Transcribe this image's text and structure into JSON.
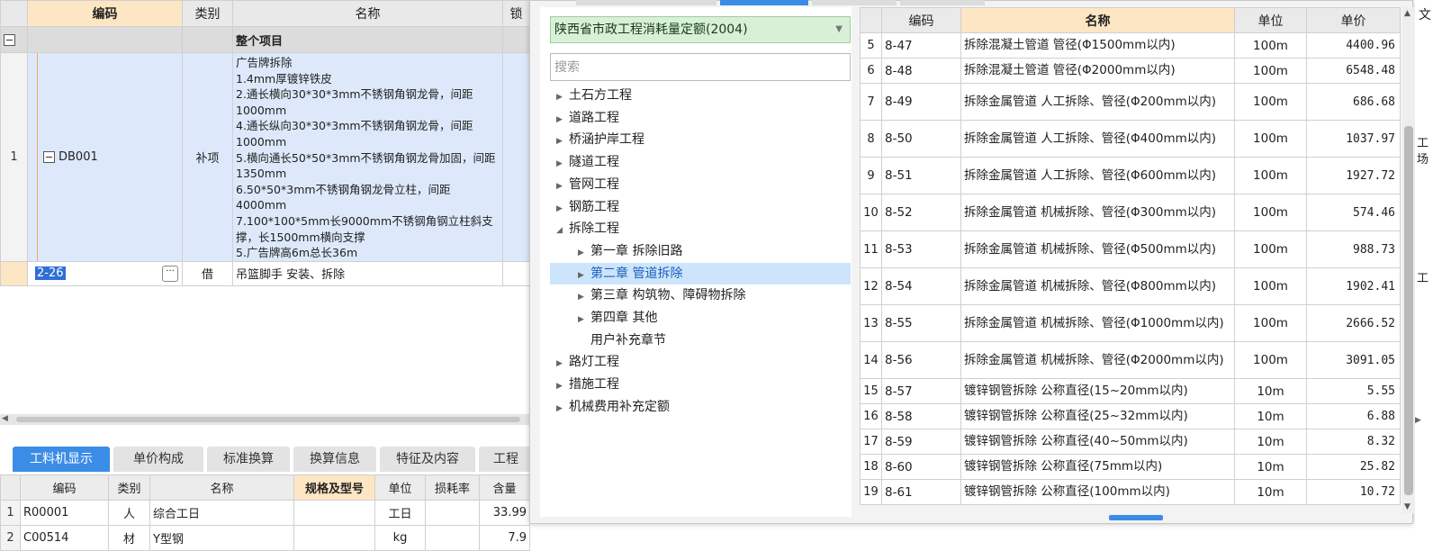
{
  "main_grid": {
    "headers": {
      "code": "编码",
      "type": "类别",
      "name": "名称",
      "lock": "锁"
    },
    "group_row": {
      "name": "整个项目"
    },
    "rows": [
      {
        "num": "1",
        "code": "DB001",
        "type": "补项",
        "desc": [
          "广告牌拆除",
          "1.4mm厚镀锌铁皮",
          "2.通长横向30*30*3mm不锈钢角钢龙骨，间距1000mm",
          "4.通长纵向30*30*3mm不锈钢角钢龙骨，间距1000mm",
          "5.横向通长50*50*3mm不锈钢角钢龙骨加固，间距1350mm",
          "6.50*50*3mm不锈钢角钢龙骨立柱，间距4000mm",
          "7.100*100*5mm长9000mm不锈钢角钢立柱斜支撑，长1500mm横向支撑",
          "5.广告牌高6m总长36m"
        ]
      },
      {
        "num": "",
        "code": "2-26",
        "type": "借",
        "name": "吊篮脚手 安装、拆除"
      }
    ]
  },
  "bottom_tabs": [
    "工料机显示",
    "单价构成",
    "标准换算",
    "换算信息",
    "特征及内容",
    "工程"
  ],
  "bottom_grid": {
    "headers": {
      "code": "编码",
      "type": "类别",
      "name": "名称",
      "spec": "规格及型号",
      "unit": "单位",
      "loss": "损耗率",
      "qty": "含量"
    },
    "rows": [
      {
        "num": "1",
        "code": "R00001",
        "type": "人",
        "name": "综合工日",
        "unit": "工日",
        "qty": "33.99"
      },
      {
        "num": "2",
        "code": "C00514",
        "type": "材",
        "name": "Y型钢",
        "unit": "kg",
        "qty": "7.9"
      }
    ]
  },
  "library": {
    "selected": "陕西省市政工程消耗量定额(2004)",
    "search_placeholder": "搜索",
    "tree": [
      {
        "label": "土石方工程",
        "level": 0,
        "expanded": false
      },
      {
        "label": "道路工程",
        "level": 0,
        "expanded": false
      },
      {
        "label": "桥涵护岸工程",
        "level": 0,
        "expanded": false
      },
      {
        "label": "隧道工程",
        "level": 0,
        "expanded": false
      },
      {
        "label": "管网工程",
        "level": 0,
        "expanded": false
      },
      {
        "label": "钢筋工程",
        "level": 0,
        "expanded": false
      },
      {
        "label": "拆除工程",
        "level": 0,
        "expanded": true
      },
      {
        "label": "第一章 拆除旧路",
        "level": 1,
        "expanded": false
      },
      {
        "label": "第二章 管道拆除",
        "level": 1,
        "expanded": false,
        "selected": true
      },
      {
        "label": "第三章 构筑物、障碍物拆除",
        "level": 1,
        "expanded": false
      },
      {
        "label": "第四章 其他",
        "level": 1,
        "expanded": false
      },
      {
        "label": "用户补充章节",
        "level": 1,
        "leaf": true
      },
      {
        "label": "路灯工程",
        "level": 0,
        "expanded": false
      },
      {
        "label": "措施工程",
        "level": 0,
        "expanded": false
      },
      {
        "label": "机械费用补充定额",
        "level": 0,
        "expanded": false
      }
    ]
  },
  "quota_grid": {
    "headers": {
      "code": "编码",
      "name": "名称",
      "unit": "单位",
      "price": "单价"
    },
    "rows": [
      {
        "num": "5",
        "code": "8-47",
        "name": "拆除混凝土管道 管径(Φ1500mm以内)",
        "unit": "100m",
        "price": "4400.96"
      },
      {
        "num": "6",
        "code": "8-48",
        "name": "拆除混凝土管道 管径(Φ2000mm以内)",
        "unit": "100m",
        "price": "6548.48"
      },
      {
        "num": "7",
        "code": "8-49",
        "name": "拆除金属管道 人工拆除、管径(Φ200mm以内)",
        "unit": "100m",
        "price": "686.68"
      },
      {
        "num": "8",
        "code": "8-50",
        "name": "拆除金属管道 人工拆除、管径(Φ400mm以内)",
        "unit": "100m",
        "price": "1037.97"
      },
      {
        "num": "9",
        "code": "8-51",
        "name": "拆除金属管道 人工拆除、管径(Φ600mm以内)",
        "unit": "100m",
        "price": "1927.72"
      },
      {
        "num": "10",
        "code": "8-52",
        "name": "拆除金属管道 机械拆除、管径(Φ300mm以内)",
        "unit": "100m",
        "price": "574.46"
      },
      {
        "num": "11",
        "code": "8-53",
        "name": "拆除金属管道 机械拆除、管径(Φ500mm以内)",
        "unit": "100m",
        "price": "988.73"
      },
      {
        "num": "12",
        "code": "8-54",
        "name": "拆除金属管道 机械拆除、管径(Φ800mm以内)",
        "unit": "100m",
        "price": "1902.41"
      },
      {
        "num": "13",
        "code": "8-55",
        "name": "拆除金属管道 机械拆除、管径(Φ1000mm以内)",
        "unit": "100m",
        "price": "2666.52"
      },
      {
        "num": "14",
        "code": "8-56",
        "name": "拆除金属管道 机械拆除、管径(Φ2000mm以内)",
        "unit": "100m",
        "price": "3091.05"
      },
      {
        "num": "15",
        "code": "8-57",
        "name": "镀锌钢管拆除 公称直径(15~20mm以内)",
        "unit": "10m",
        "price": "5.55"
      },
      {
        "num": "16",
        "code": "8-58",
        "name": "镀锌钢管拆除 公称直径(25~32mm以内)",
        "unit": "10m",
        "price": "6.88"
      },
      {
        "num": "17",
        "code": "8-59",
        "name": "镀锌钢管拆除 公称直径(40~50mm以内)",
        "unit": "10m",
        "price": "8.32"
      },
      {
        "num": "18",
        "code": "8-60",
        "name": "镀锌钢管拆除 公称直径(75mm以内)",
        "unit": "10m",
        "price": "25.82"
      },
      {
        "num": "19",
        "code": "8-61",
        "name": "镀锌钢管拆除 公称直径(100mm以内)",
        "unit": "10m",
        "price": "10.72"
      }
    ]
  },
  "right_edge": {
    "top_char": "文",
    "mid_a": "工",
    "mid_b": "场",
    "mid_c": "工"
  },
  "colors": {
    "accent": "#3b8ce6",
    "selection": "#dde9fb",
    "header_highlight": "#fde6c3",
    "library_select": "#d8f0d8"
  }
}
